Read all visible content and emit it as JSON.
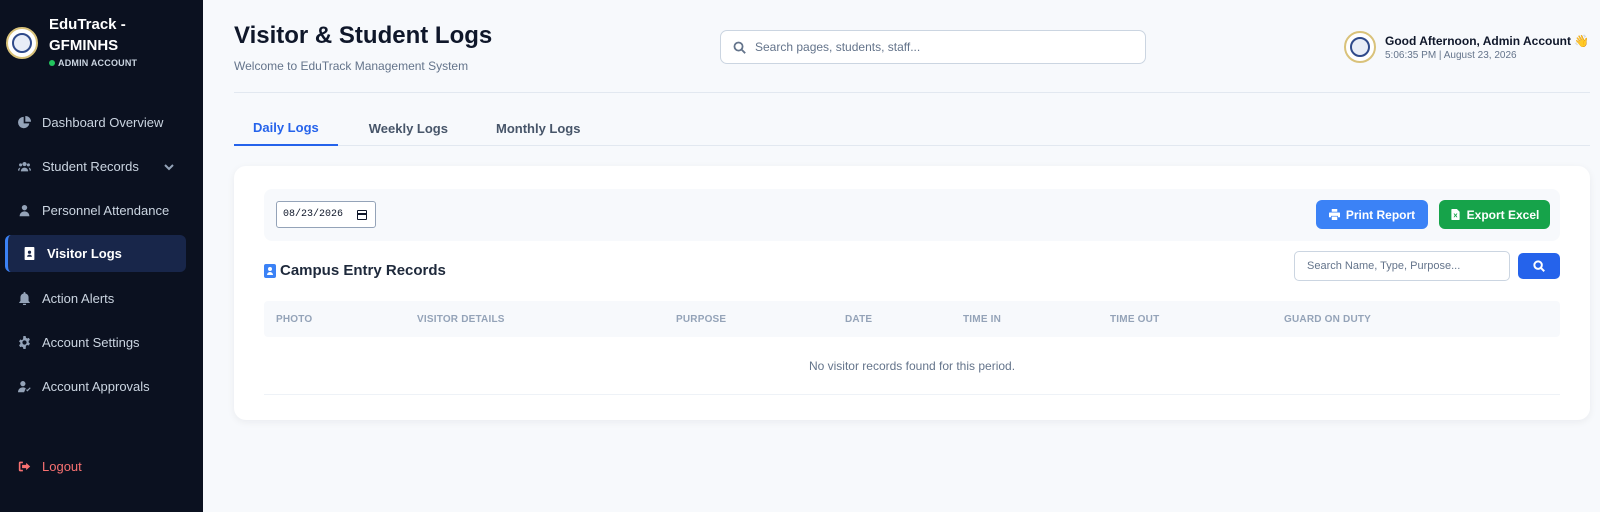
{
  "app": {
    "brand_title": "EduTrack - GFMINHS",
    "brand_subtitle": "ADMIN ACCOUNT"
  },
  "sidebar": {
    "items": [
      {
        "label": "Dashboard Overview",
        "icon": "chart-pie-icon"
      },
      {
        "label": "Student Records",
        "icon": "users-icon"
      },
      {
        "label": "Personnel Attendance",
        "icon": "user-icon"
      },
      {
        "label": "Visitor Logs",
        "icon": "id-badge-icon",
        "active": true
      },
      {
        "label": "Action Alerts",
        "icon": "bell-icon"
      },
      {
        "label": "Account Settings",
        "icon": "gear-icon"
      },
      {
        "label": "Account Approvals",
        "icon": "user-check-icon"
      }
    ],
    "logout_label": "Logout"
  },
  "header": {
    "title": "Visitor & Student Logs",
    "subtitle": "Welcome to EduTrack Management System",
    "search_placeholder": "Search pages, students, staff...",
    "greeting": "Good Afternoon, Admin Account",
    "wave": "👋",
    "clock": "5:06:35 PM | August 23, 2026"
  },
  "tabs": [
    {
      "label": "Daily Logs",
      "active": true
    },
    {
      "label": "Weekly Logs"
    },
    {
      "label": "Monthly Logs"
    }
  ],
  "toolbar": {
    "date_value": "08/23/2026",
    "print_label": "Print Report",
    "export_label": "Export Excel"
  },
  "records": {
    "title": "Campus Entry Records",
    "filter_placeholder": "Search Name, Type, Purpose...",
    "columns": [
      "PHOTO",
      "VISITOR DETAILS",
      "PURPOSE",
      "DATE",
      "TIME IN",
      "TIME OUT",
      "GUARD ON DUTY"
    ],
    "empty_message": "No visitor records found for this period."
  },
  "colors": {
    "sidebar_bg": "#0b1120",
    "accent": "#2563eb",
    "print_button": "#3b82f6",
    "export_button": "#16a34a",
    "logout": "#f87171"
  }
}
